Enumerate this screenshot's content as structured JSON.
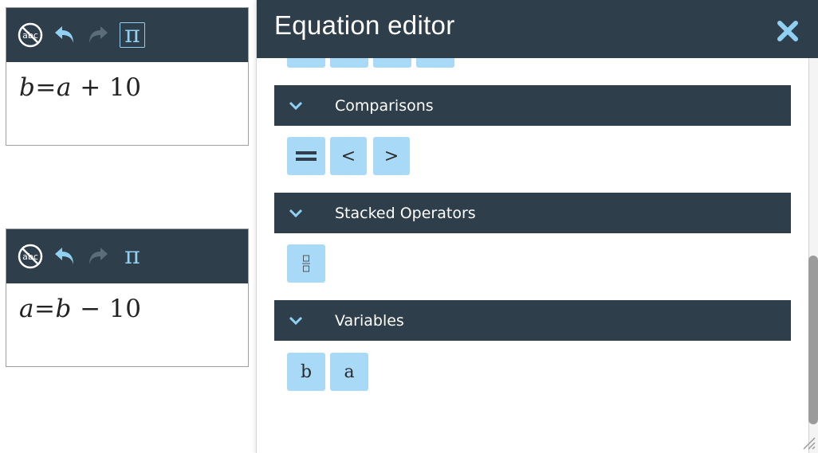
{
  "answer_boxes": [
    {
      "expression": {
        "lhs": "b",
        "eq": "=",
        "a": "a",
        "op": "+",
        "num": "10"
      },
      "pi_active": true
    },
    {
      "expression": {
        "lhs": "a",
        "eq": "=",
        "a": "b",
        "op": "−",
        "num": "10"
      },
      "pi_active": false
    }
  ],
  "toolbar": {
    "icons": [
      "spellcheck-off-icon",
      "undo-icon",
      "redo-icon",
      "pi-icon"
    ],
    "pi_glyph": "π"
  },
  "editor": {
    "title": "Equation editor",
    "close_icon": "close-icon",
    "sections": [
      {
        "label": "Comparisons",
        "keys": [
          "=",
          "<",
          ">"
        ]
      },
      {
        "label": "Stacked Operators",
        "keys": [
          "fraction"
        ]
      },
      {
        "label": "Variables",
        "keys": [
          "b",
          "a"
        ]
      }
    ]
  },
  "colors": {
    "header": "#2f3e4b",
    "key_bg": "#a8daf8",
    "accent": "#8fd0f3"
  }
}
